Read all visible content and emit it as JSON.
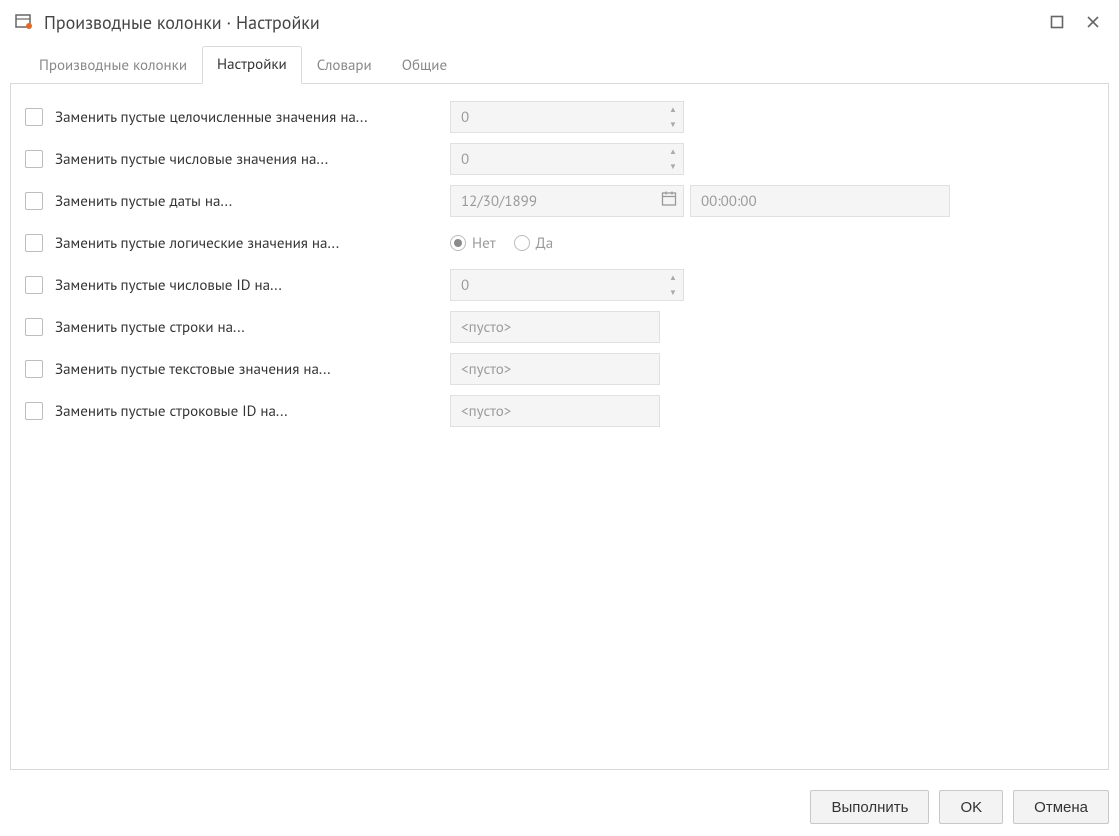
{
  "window": {
    "title": "Производные колонки · Настройки"
  },
  "tabs": [
    {
      "label": "Производные колонки",
      "active": false
    },
    {
      "label": "Настройки",
      "active": true
    },
    {
      "label": "Словари",
      "active": false
    },
    {
      "label": "Общие",
      "active": false
    }
  ],
  "rows": {
    "int": {
      "label": "Заменить пустые целочисленные значения на...",
      "value": "0"
    },
    "num": {
      "label": "Заменить пустые числовые значения на...",
      "value": "0"
    },
    "date": {
      "label": "Заменить пустые даты на...",
      "date": "12/30/1899",
      "time": "00:00:00"
    },
    "bool": {
      "label": "Заменить пустые логические значения на...",
      "no": "Нет",
      "yes": "Да"
    },
    "numid": {
      "label": "Заменить пустые числовые ID на...",
      "value": "0"
    },
    "str": {
      "label": "Заменить пустые строки на...",
      "placeholder": "<пусто>"
    },
    "text": {
      "label": "Заменить пустые текстовые значения на...",
      "placeholder": "<пусто>"
    },
    "strid": {
      "label": "Заменить пустые строковые ID на...",
      "placeholder": "<пусто>"
    }
  },
  "footer": {
    "run": "Выполнить",
    "ok": "OK",
    "cancel": "Отмена"
  }
}
